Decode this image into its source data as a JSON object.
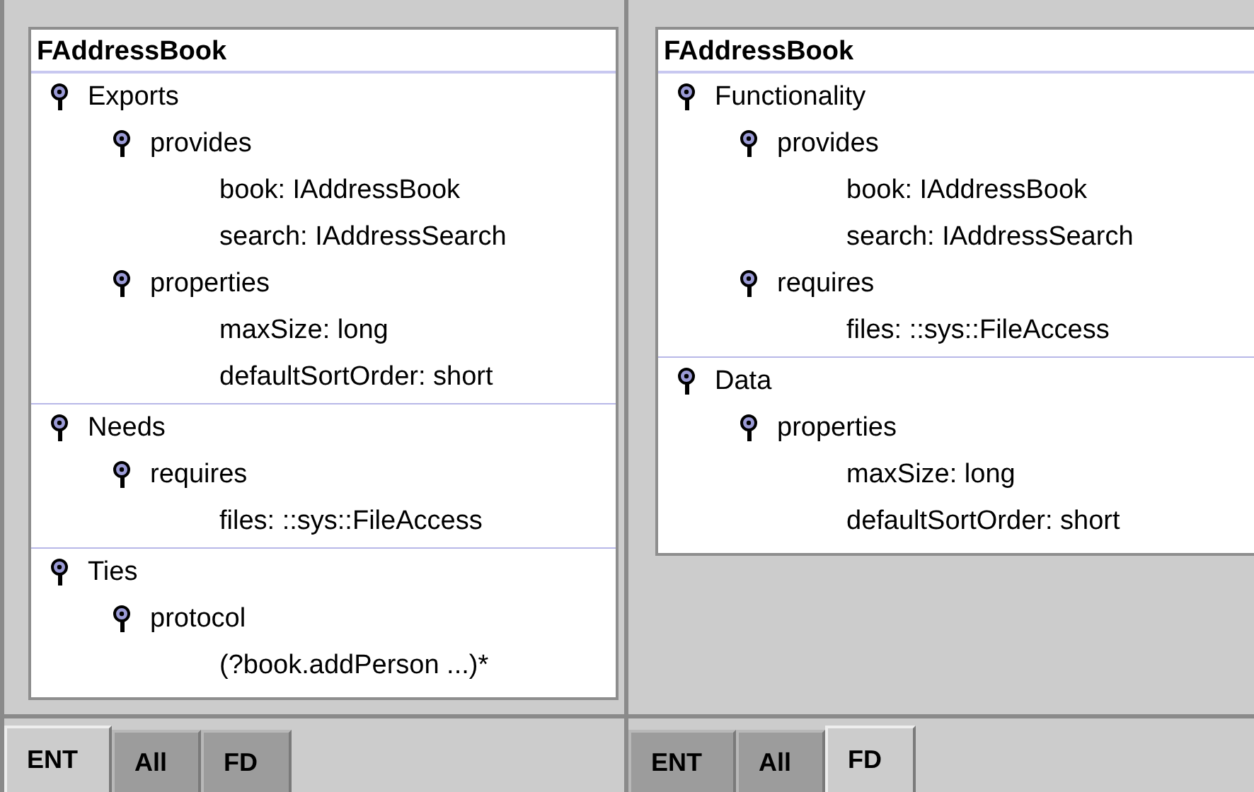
{
  "panes": [
    {
      "card": {
        "title": "FAddressBook",
        "sections": [
          {
            "label": "Exports",
            "children": [
              {
                "label": "provides",
                "children": [
                  {
                    "label": "book: IAddressBook"
                  },
                  {
                    "label": "search: IAddressSearch"
                  }
                ]
              },
              {
                "label": "properties",
                "children": [
                  {
                    "label": "maxSize: long"
                  },
                  {
                    "label": "defaultSortOrder: short"
                  }
                ]
              }
            ]
          },
          {
            "label": "Needs",
            "children": [
              {
                "label": "requires",
                "children": [
                  {
                    "label": "files: ::sys::FileAccess"
                  }
                ]
              }
            ]
          },
          {
            "label": "Ties",
            "children": [
              {
                "label": "protocol",
                "children": [
                  {
                    "label": "(?book.addPerson ...)*"
                  }
                ]
              }
            ]
          }
        ]
      },
      "tabs": [
        {
          "label": "ENT",
          "selected": true
        },
        {
          "label": "All",
          "selected": false
        },
        {
          "label": "FD",
          "selected": false
        }
      ]
    },
    {
      "card": {
        "title": "FAddressBook",
        "sections": [
          {
            "label": "Functionality",
            "children": [
              {
                "label": "provides",
                "children": [
                  {
                    "label": "book: IAddressBook"
                  },
                  {
                    "label": "search: IAddressSearch"
                  }
                ]
              },
              {
                "label": "requires",
                "children": [
                  {
                    "label": "files: ::sys::FileAccess"
                  }
                ]
              }
            ]
          },
          {
            "label": "Data",
            "children": [
              {
                "label": "properties",
                "children": [
                  {
                    "label": "maxSize: long"
                  },
                  {
                    "label": "defaultSortOrder: short"
                  }
                ]
              }
            ]
          }
        ]
      },
      "tabs": [
        {
          "label": "ENT",
          "selected": false
        },
        {
          "label": "All",
          "selected": false
        },
        {
          "label": "FD",
          "selected": true
        }
      ]
    }
  ]
}
